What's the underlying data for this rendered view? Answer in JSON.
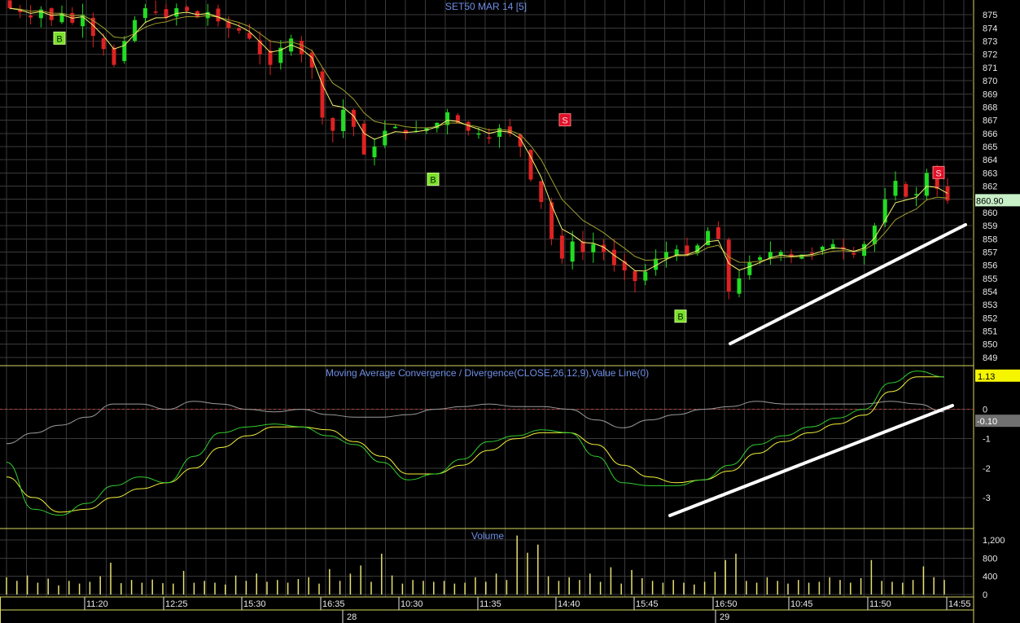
{
  "colors": {
    "background": "#000000",
    "grid": "#3a3a3a",
    "separator": "#d8d860",
    "up": "#22dd22",
    "down": "#dd2222",
    "ma_fast": "#f4f470",
    "ma_slow": "#9e9e30",
    "macd": "#2fcf2f",
    "signal": "#f2f23a",
    "histogram": "#9a9a9a",
    "volume": "#e8e070",
    "title": "#6f8fe6",
    "trendline": "#ffffff"
  },
  "price_panel": {
    "title": "SET50 MAR 14   [5]",
    "last_value": "860.90",
    "y_ticks": [
      875,
      874,
      873,
      872,
      871,
      870,
      869,
      868,
      867,
      866,
      865,
      864,
      863,
      862,
      861,
      860,
      859,
      858,
      857,
      856,
      855,
      854,
      853,
      852,
      851,
      850,
      849
    ]
  },
  "macd_panel": {
    "title": "Moving Average Convergence / Divergence(CLOSE,26,12,9),Value Line(0)",
    "y_ticks": [
      "0",
      "-1",
      "-2",
      "-3"
    ],
    "macd_value": "1.13",
    "hist_value": "-0.10"
  },
  "volume_panel": {
    "title": "Volume",
    "y_ticks": [
      "1,200",
      "800",
      "400",
      "0"
    ]
  },
  "time_axis": {
    "labels": [
      "11:20",
      "12:25",
      "15:30",
      "16:35",
      "10:30",
      "11:35",
      "14:40",
      "15:45",
      "16:50",
      "10:45",
      "11:50",
      "14:55"
    ],
    "dates": [
      "28",
      "29"
    ]
  },
  "chart_data": [
    {
      "type": "candlestick",
      "title": "SET50 MAR 14   [5]",
      "ylim": [
        848.5,
        876
      ],
      "x_labels": [
        "11:20",
        "12:25",
        "15:30",
        "16:35",
        "10:30",
        "11:35",
        "14:40",
        "15:45",
        "16:50",
        "10:45",
        "11:50",
        "14:55"
      ],
      "close_path": [
        875.5,
        875.2,
        874.8,
        875.4,
        874.6,
        875.1,
        874.4,
        875.0,
        873.4,
        872.4,
        871.2,
        873.0,
        874.6,
        875.5,
        875.2,
        874.8,
        875.5,
        875.3,
        874.8,
        875.2,
        874.5,
        874.0,
        873.8,
        873.2,
        872.0,
        871.2,
        872.5,
        873.2,
        872.0,
        871.0,
        867.2,
        866.2,
        867.8,
        866.5,
        864.4,
        865.0,
        866.2,
        866.5,
        866.0,
        866.2,
        866.4,
        866.8,
        867.6,
        866.8,
        866.2,
        866.0,
        865.6,
        866.4,
        866.0,
        865.0,
        862.5,
        860.8,
        858.0,
        856.5,
        857.8,
        857.0,
        857.6,
        857.0,
        856.0,
        855.6,
        854.8,
        855.5,
        856.5,
        857.0,
        857.2,
        856.8,
        857.5,
        858.6,
        858.0,
        854.0,
        855.0,
        856.2,
        856.6,
        857.0,
        857.0,
        856.6,
        856.8,
        856.9,
        857.4,
        857.6,
        857.2,
        856.8,
        857.6,
        859.0,
        861.0,
        862.4,
        861.2,
        861.4,
        863.0,
        861.8,
        860.9
      ],
      "markers": [
        {
          "label": "B",
          "x_label": "11:20",
          "price": 873.2
        },
        {
          "label": "B",
          "x_label": "10:30",
          "price": 862.5
        },
        {
          "label": "S",
          "x_label": "14:40",
          "price": 867.0
        },
        {
          "label": "B",
          "x_label": "15:45",
          "price": 852.1
        },
        {
          "label": "S",
          "x_label": "14:55",
          "price": 863.0
        }
      ],
      "series": [
        {
          "name": "candles"
        },
        {
          "name": "moving average (fast)"
        },
        {
          "name": "moving average (slow)"
        }
      ],
      "last_value": 860.9
    },
    {
      "type": "line",
      "title": "Moving Average Convergence / Divergence(CLOSE,26,12,9),Value Line(0)",
      "ylim": [
        -4.0,
        1.4
      ],
      "reference_line": 0,
      "series": [
        {
          "name": "MACD",
          "points": [
            -1.8,
            -3.4,
            -3.6,
            -3.2,
            -2.6,
            -2.3,
            -2.5,
            -1.6,
            -0.8,
            -0.6,
            -0.5,
            -0.6,
            -0.9,
            -1.2,
            -1.8,
            -2.4,
            -2.2,
            -1.7,
            -1.1,
            -0.9,
            -0.7,
            -0.8,
            -1.6,
            -2.5,
            -2.6,
            -2.6,
            -2.4,
            -1.9,
            -1.2,
            -0.9,
            -0.6,
            -0.3,
            0.0,
            0.9,
            1.3,
            1.1
          ]
        },
        {
          "name": "Signal",
          "points": [
            -2.3,
            -3.0,
            -3.5,
            -3.4,
            -3.0,
            -2.7,
            -2.5,
            -2.0,
            -1.3,
            -0.9,
            -0.6,
            -0.6,
            -0.7,
            -1.1,
            -1.6,
            -2.2,
            -2.2,
            -1.9,
            -1.4,
            -1.0,
            -0.8,
            -0.8,
            -1.2,
            -1.9,
            -2.3,
            -2.5,
            -2.4,
            -2.1,
            -1.5,
            -1.1,
            -0.8,
            -0.5,
            -0.2,
            0.6,
            1.1,
            1.1
          ]
        },
        {
          "name": "Histogram",
          "points": [
            -1.3,
            -0.9,
            -0.6,
            -0.3,
            0.2,
            0.2,
            0.0,
            0.3,
            0.2,
            0.0,
            -0.1,
            0.0,
            -0.2,
            -0.3,
            -0.3,
            -0.2,
            0.0,
            0.1,
            0.2,
            0.1,
            0.1,
            0.0,
            -0.4,
            -0.7,
            -0.4,
            -0.2,
            0.0,
            0.1,
            0.3,
            0.2,
            0.2,
            0.2,
            0.2,
            0.3,
            0.2,
            -0.1
          ]
        }
      ],
      "values_shown": {
        "macd": 1.13,
        "histogram": -0.1
      }
    },
    {
      "type": "bar",
      "title": "Volume",
      "ylim": [
        0,
        1400
      ],
      "y_ticks": [
        0,
        400,
        800,
        1200
      ],
      "values": [
        380,
        300,
        420,
        260,
        350,
        200,
        300,
        240,
        280,
        400,
        700,
        250,
        320,
        260,
        330,
        250,
        240,
        520,
        260,
        300,
        260,
        220,
        420,
        300,
        460,
        280,
        320,
        260,
        340,
        380,
        240,
        560,
        300,
        460,
        640,
        280,
        900,
        420,
        240,
        320,
        300,
        280,
        300,
        240,
        260,
        380,
        280,
        460,
        320,
        1300,
        920,
        1100,
        400,
        300,
        380,
        320,
        460,
        280,
        600,
        240,
        540,
        360,
        300,
        260,
        320,
        260,
        220,
        280,
        500,
        760,
        900,
        300,
        260,
        380,
        300,
        240,
        320,
        260,
        280,
        380,
        320,
        260,
        360,
        760,
        300,
        280,
        260,
        320,
        620,
        380,
        320
      ]
    }
  ]
}
